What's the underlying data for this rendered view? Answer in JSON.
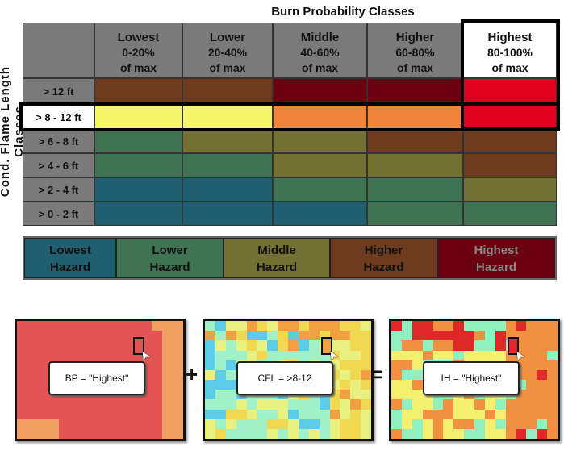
{
  "title": "Burn Probability Classes",
  "y_axis_label": "Cond. Flame Length Classes",
  "columns": [
    {
      "name": "Lowest",
      "range": "0-20%",
      "unit": "of max"
    },
    {
      "name": "Lower",
      "range": "20-40%",
      "unit": "of max"
    },
    {
      "name": "Middle",
      "range": "40-60%",
      "unit": "of max"
    },
    {
      "name": "Higher",
      "range": "60-80%",
      "unit": "of max"
    },
    {
      "name": "Highest",
      "range": "80-100%",
      "unit": "of max"
    }
  ],
  "rows": [
    {
      "label": "> 12 ft",
      "cells": [
        "higher",
        "higher",
        "highest",
        "highest",
        "#e00020"
      ]
    },
    {
      "label": "> 8 - 12 ft",
      "cells": [
        "#f5f56a",
        "#f5f56a",
        "#f0843a",
        "#f0843a",
        "#e00020"
      ]
    },
    {
      "label": "> 6 - 8 ft",
      "cells": [
        "lower",
        "middle",
        "middle",
        "higher",
        "higher"
      ]
    },
    {
      "label": "> 4 - 6 ft",
      "cells": [
        "lower",
        "lower",
        "middle",
        "middle",
        "higher"
      ]
    },
    {
      "label": "> 2 - 4 ft",
      "cells": [
        "lowest",
        "lowest",
        "lower",
        "lower",
        "middle"
      ]
    },
    {
      "label": "> 0 - 2 ft",
      "cells": [
        "lowest",
        "lowest",
        "lowest",
        "lower",
        "lower"
      ]
    }
  ],
  "legend": [
    {
      "key": "lowest",
      "line1": "Lowest",
      "line2": "Hazard",
      "color": "#1f5f70",
      "text": "#111"
    },
    {
      "key": "lower",
      "line1": "Lower",
      "line2": "Hazard",
      "color": "#3f7354",
      "text": "#111"
    },
    {
      "key": "middle",
      "line1": "Middle",
      "line2": "Hazard",
      "color": "#727033",
      "text": "#111"
    },
    {
      "key": "higher",
      "line1": "Higher",
      "line2": "Hazard",
      "color": "#6e3b1e",
      "text": "#111"
    },
    {
      "key": "highest",
      "line1": "Highest",
      "line2": "Hazard",
      "color": "#6a0010",
      "text": "#888"
    }
  ],
  "highlight": {
    "row": "> 8 - 12 ft",
    "column": "Highest"
  },
  "maps": [
    {
      "label": "BP = \"Highest\"",
      "palette": [
        "#e55454",
        "#f0a060"
      ]
    },
    {
      "label": "CFL = >8-12",
      "palette": [
        "#a0f0c8",
        "#e8f080",
        "#f0d850",
        "#f0a040",
        "#5ccce8"
      ]
    },
    {
      "label": "IH = \"Highest\"",
      "palette": [
        "#f5f070",
        "#f09040",
        "#90f0c0",
        "#e02828"
      ]
    }
  ],
  "operators": {
    "plus": "+",
    "equals": "="
  }
}
